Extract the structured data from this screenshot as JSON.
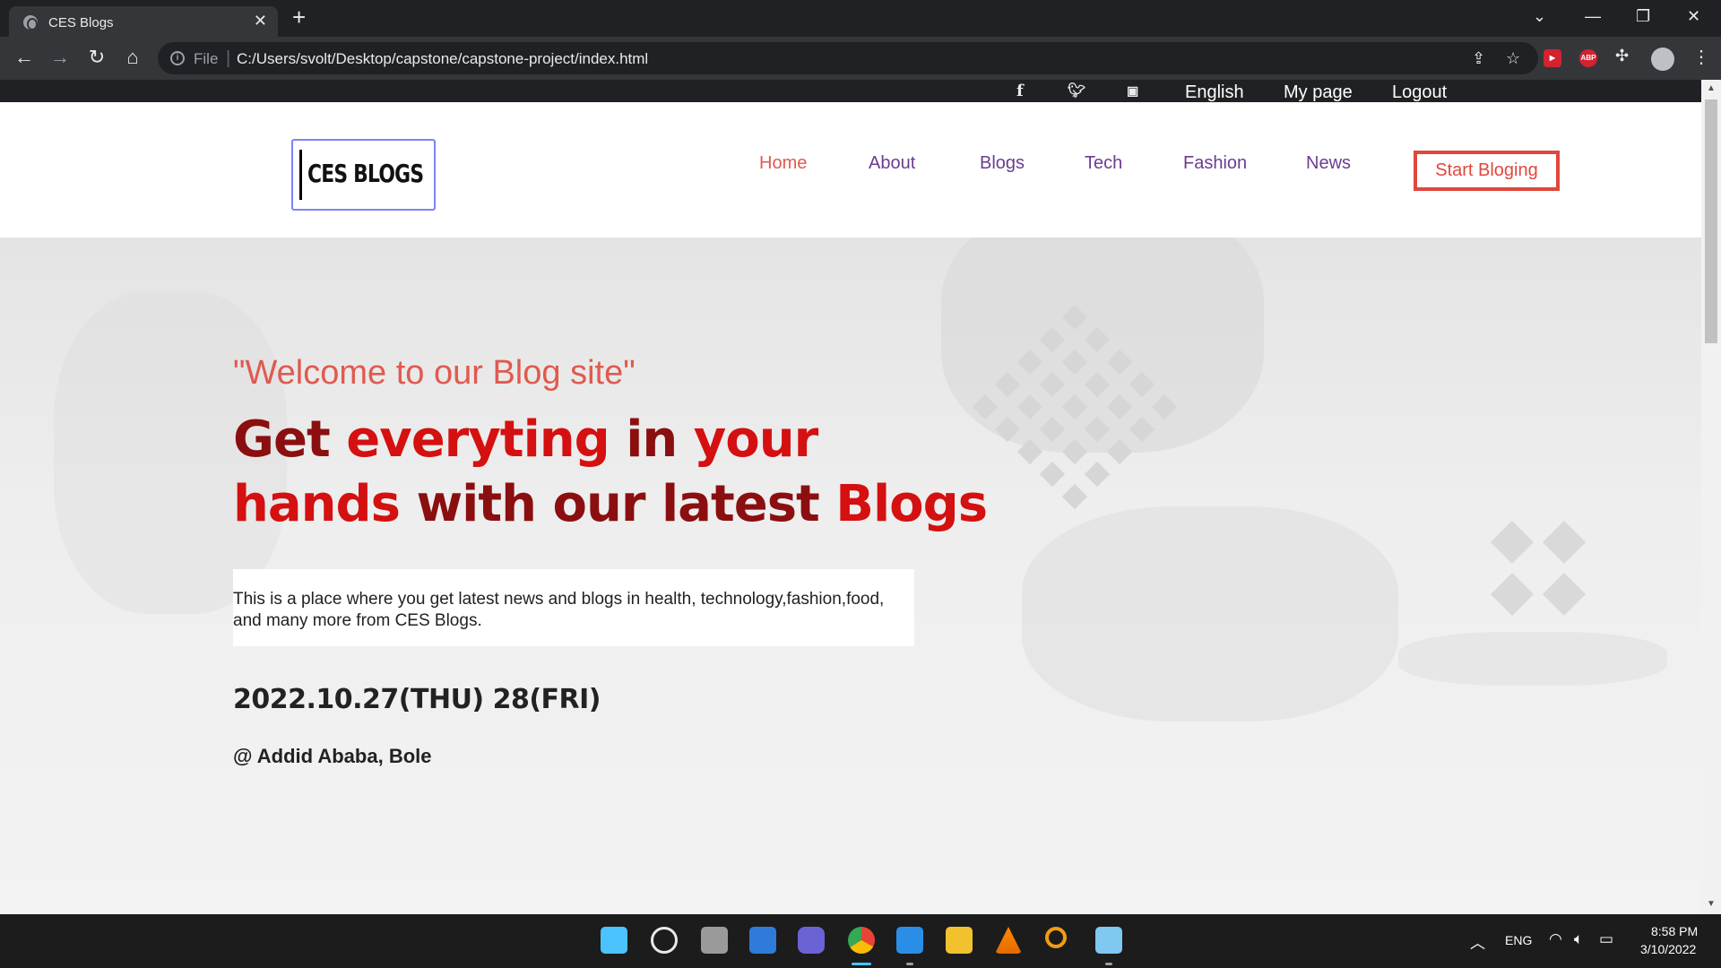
{
  "browser": {
    "tab_title": "CES Blogs",
    "tab_close": "✕",
    "new_tab": "+",
    "omnibox_scheme": "File",
    "omnibox_url": "C:/Users/svolt/Desktop/capstone/capstone-project/index.html",
    "ext_abp": "ABP"
  },
  "page": {
    "top_links": [
      "English",
      "My page",
      "Logout"
    ],
    "logo_text": "CES BLOGS",
    "nav": [
      "Home",
      "About",
      "Blogs",
      "Tech",
      "Fashion",
      "News"
    ],
    "cta_label": "Start Bloging",
    "hero": {
      "welcome": "\"Welcome to our Blog site\"",
      "headline_line1_part1": "Get ",
      "headline_line1_part2": "everyting",
      "headline_line1_part3": " in ",
      "headline_line1_part4": "your",
      "headline_line2_part1": "hands",
      "headline_line2_part2": " with our latest ",
      "headline_line2_part3": "Blogs",
      "description": "This is a place where you get latest news and blogs in health, technology,fashion,food, and many more from CES Blogs.",
      "date": "2022.10.27(THU) 28(FRI)",
      "location": "@ Addid Ababa, Bole"
    }
  },
  "taskbar": {
    "lang": "ENG",
    "time": "8:58 PM",
    "date": "3/10/2022"
  },
  "colors": {
    "accent_red": "#e05a4f",
    "nav_purple": "#6a3d8f",
    "headline_dark_red": "#8b0f10",
    "headline_bright_red": "#d41010"
  }
}
